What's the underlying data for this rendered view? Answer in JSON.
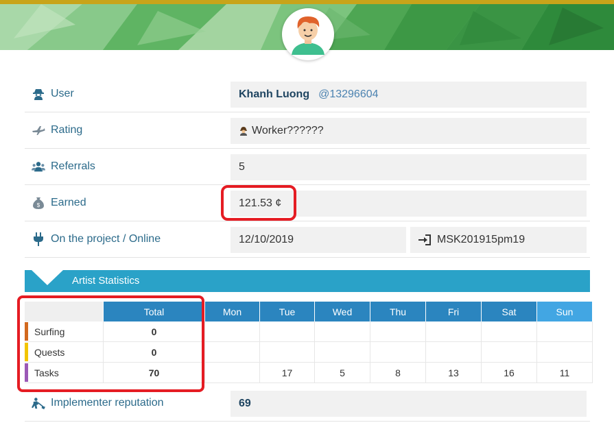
{
  "profile": {
    "rows": {
      "user": {
        "label": "User",
        "name": "Khanh Luong",
        "id": "@13296604"
      },
      "rating": {
        "label": "Rating",
        "value": "Worker??????"
      },
      "referrals": {
        "label": "Referrals",
        "value": "5"
      },
      "earned": {
        "label": "Earned",
        "value": "121.53 ¢"
      },
      "online": {
        "label": "On the project / Online",
        "date": "12/10/2019",
        "last": "MSK201915pm19"
      }
    }
  },
  "stats": {
    "title": "Artist Statistics",
    "columns": [
      "Total",
      "Mon",
      "Tue",
      "Wed",
      "Thu",
      "Fri",
      "Sat",
      "Sun"
    ],
    "rows": [
      {
        "name": "Surfing",
        "color": "#d2691e",
        "cells": [
          "0",
          "",
          "",
          "",
          "",
          "",
          "",
          ""
        ]
      },
      {
        "name": "Quests",
        "color": "#f2c500",
        "cells": [
          "0",
          "",
          "",
          "",
          "",
          "",
          "",
          ""
        ]
      },
      {
        "name": "Tasks",
        "color": "#9b59b6",
        "cells": [
          "70",
          "",
          "17",
          "5",
          "8",
          "13",
          "16",
          "11"
        ]
      }
    ]
  },
  "reputation": {
    "label": "Implementer reputation",
    "value": "69"
  },
  "colors": {
    "accent": "#2aa2c8",
    "header_blue": "#2b85bf",
    "callout_red": "#e51c23",
    "label_blue": "#2b6a8a"
  },
  "icons": [
    "banner-pattern",
    "avatar-icon",
    "spy-icon",
    "plane-icon",
    "users-icon",
    "money-bag-icon",
    "plug-icon",
    "sign-in-icon",
    "worker-icon",
    "digging-icon"
  ]
}
